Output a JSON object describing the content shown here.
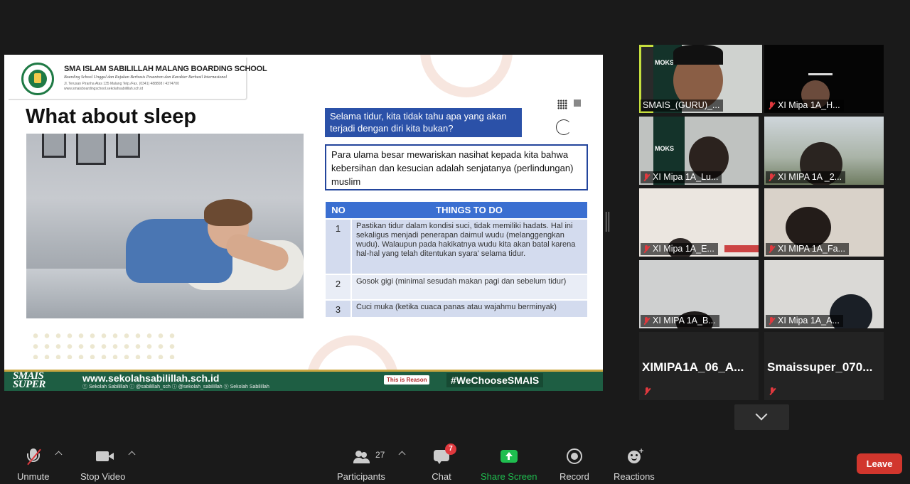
{
  "slide": {
    "school": {
      "name": "SMA ISLAM SABILILLAH MALANG BOARDING SCHOOL",
      "tagline": "Boarding School Unggul dan Rujukan Berbasis Pesantren dan Karakter Berhasil Internasional",
      "address": "Jl. Terusan Piranha Atas 135 Malang  Telp./Fax. (0341) 488808 / 4374700",
      "web": "www.smaisboardingschool.sekolahsabilillah.sch.id"
    },
    "title": "What about sleep",
    "question": "Selama tidur, kita tidak tahu apa yang akan terjadi dengan diri kita bukan?",
    "statement": "Para ulama besar mewariskan nasihat kepada kita bahwa kebersihan dan kesucian adalah senjatanya (perlindungan) muslim",
    "table": {
      "headers": [
        "NO",
        "THINGS TO DO"
      ],
      "rows": [
        {
          "no": "1",
          "text": "Pastikan tidur dalam kondisi suci, tidak memiliki hadats. Hal ini sekaligus menjadi penerapan daimul wudu (melanggengkan wudu). Walaupun pada hakikatnya wudu kita akan batal karena hal-hal yang telah ditentukan syara' selama tidur."
        },
        {
          "no": "2",
          "text": "Gosok gigi (minimal sesudah makan pagi dan sebelum tidur)"
        },
        {
          "no": "3",
          "text": "Cuci muka (ketika cuaca panas atau wajahmu berminyak)"
        }
      ]
    },
    "footer": {
      "brand_line1": "SMAIS",
      "brand_line2": "SUPER",
      "url": "www.sekolahsabilillah.sch.id",
      "social": "ⓕ Sekolah Sabilillah   ⓘ @sabilillah_sch   ⓘ @sekolah_sabilillah   ⓨ Sekolah Sabilillah",
      "reason": "This is Reason",
      "hashtag": "#WeChooseSMAIS"
    }
  },
  "participants": [
    {
      "name": "SMAIS_(GURU)_...",
      "muted": false,
      "speaking": true
    },
    {
      "name": "XI Mipa 1A_H...",
      "muted": true
    },
    {
      "name": "XI Mipa 1A_Lu...",
      "muted": true
    },
    {
      "name": "XI MIPA 1A _2...",
      "muted": true
    },
    {
      "name": "XI Mipa 1A_E...",
      "muted": true
    },
    {
      "name": "XI MIPA 1A_Fa...",
      "muted": true
    },
    {
      "name": "XI MIPA 1A_B...",
      "muted": true
    },
    {
      "name": "XI Mipa 1A_A...",
      "muted": true
    },
    {
      "name": "XIMIPA1A_06_A...",
      "muted": true,
      "video_off": true
    },
    {
      "name": "Smaissuper_070...",
      "muted": true,
      "video_off": true
    }
  ],
  "toolbar": {
    "unmute": "Unmute",
    "stop_video": "Stop Video",
    "participants": "Participants",
    "participants_count": "27",
    "chat": "Chat",
    "chat_badge": "7",
    "share_screen": "Share Screen",
    "record": "Record",
    "reactions": "Reactions",
    "leave": "Leave"
  },
  "colors": {
    "share_accent": "#1fbe4f",
    "leave_red": "#d1362d",
    "speaker_highlight": "#c6df3e",
    "slide_blue": "#2b51a8",
    "footer_green": "#1e5e43"
  }
}
